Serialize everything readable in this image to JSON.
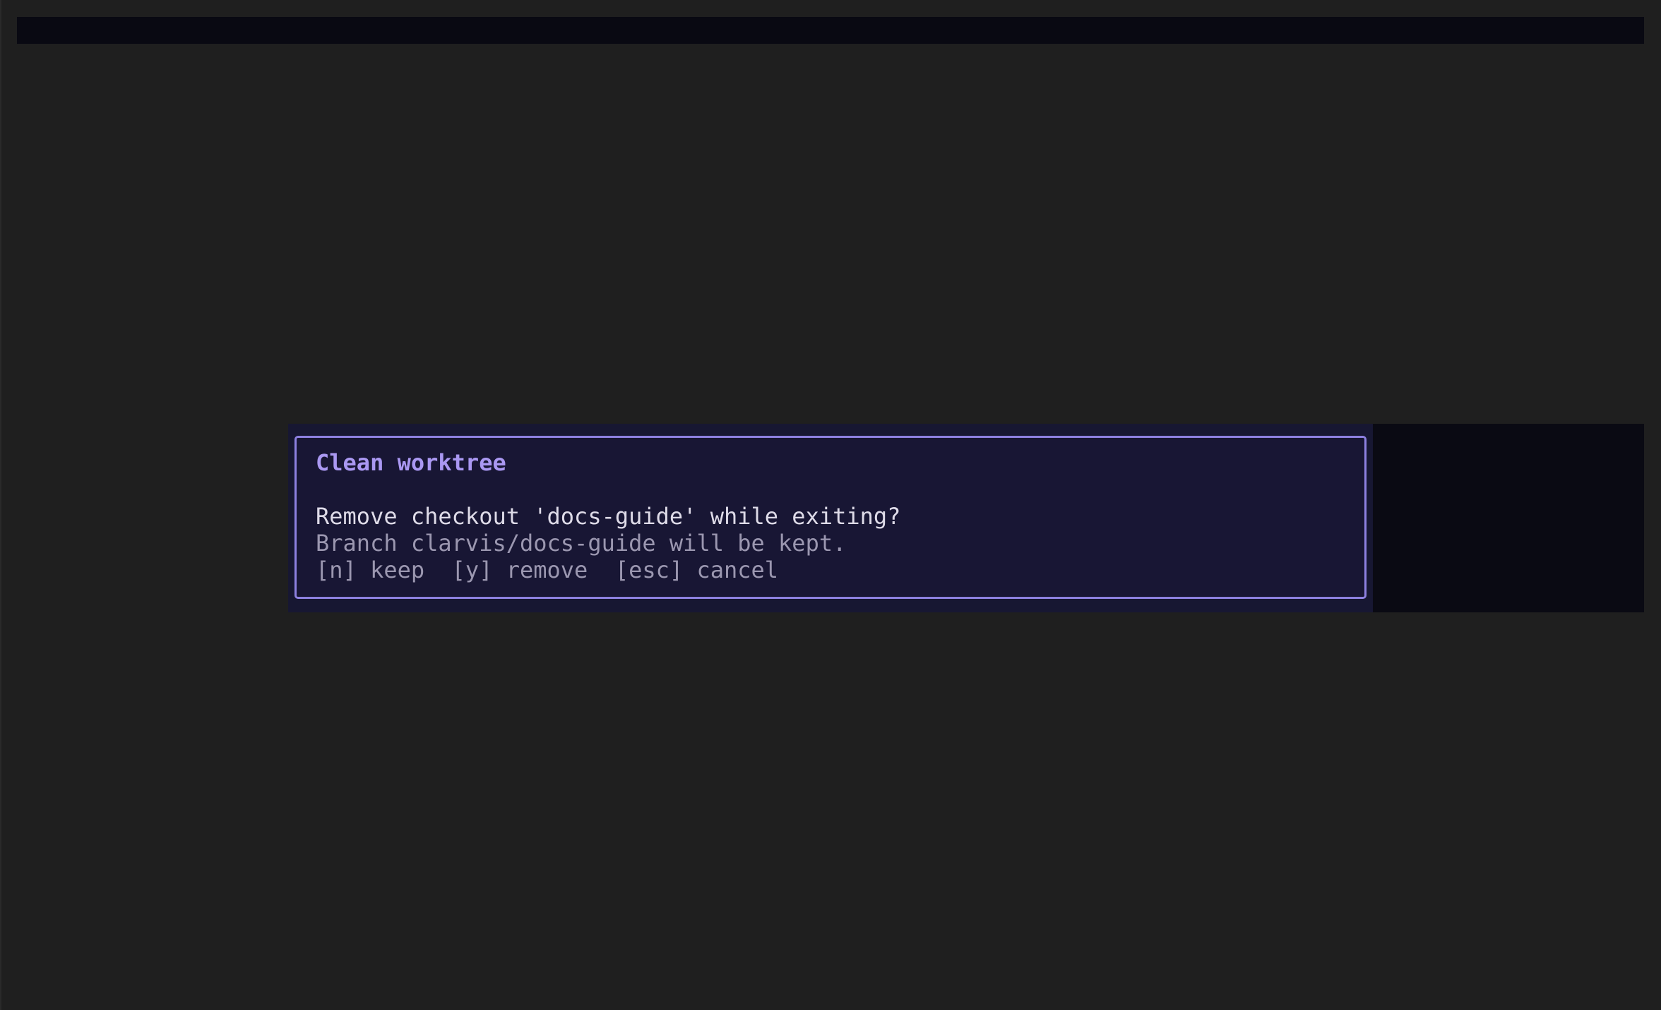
{
  "dialog": {
    "title": "Clean worktree",
    "question": "Remove checkout 'docs-guide' while exiting?",
    "branch_note": "Branch clarvis/docs-guide will be kept.",
    "actions": "[n] keep  [y] remove  [esc] cancel"
  },
  "colors": {
    "background": "#1f1f1f",
    "accent": "#8d80e0",
    "title": "#aa98f2",
    "dialog_background": "#181634"
  }
}
